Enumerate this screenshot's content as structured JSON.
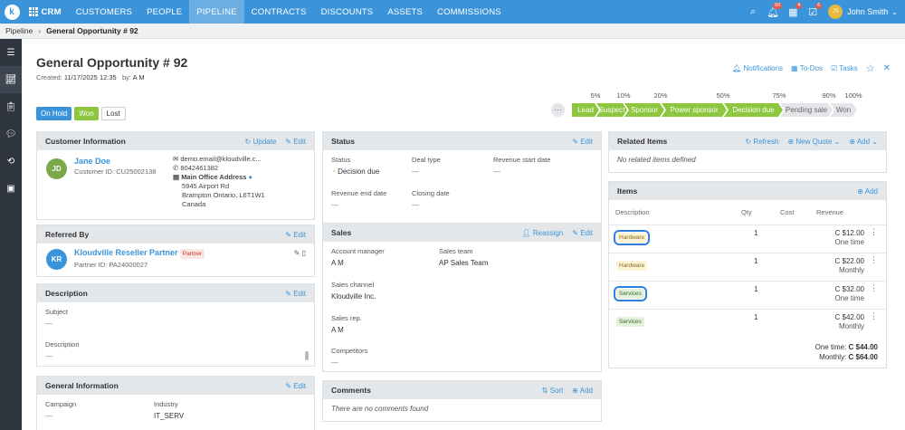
{
  "nav": {
    "app": "CRM",
    "items": [
      "CUSTOMERS",
      "PEOPLE",
      "PIPELINE",
      "CONTRACTS",
      "DISCOUNTS",
      "ASSETS",
      "COMMISSIONS"
    ],
    "active": "PIPELINE",
    "badges": {
      "notifications": "50",
      "todos": "4",
      "tasks": "6"
    },
    "user_initials": "JS",
    "user_name": "John Smith"
  },
  "breadcrumb": {
    "parent": "Pipeline",
    "current": "General Opportunity # 92"
  },
  "header": {
    "title": "General Opportunity # 92",
    "created_label": "Created:",
    "created_value": "11/17/2025 12:35",
    "by_label": "by:",
    "by_value": "A M",
    "notifications": "Notifications",
    "todos": "To-Dos",
    "tasks": "Tasks"
  },
  "status_buttons": {
    "on_hold": "On Hold",
    "won": "Won",
    "lost": "Lost"
  },
  "stages": [
    {
      "name": "Lead",
      "pct": "5%",
      "done": true
    },
    {
      "name": "Suspect",
      "pct": "10%",
      "done": true
    },
    {
      "name": "Sponsor",
      "pct": "20%",
      "done": true
    },
    {
      "name": "Power sponsor",
      "pct": "50%",
      "done": true
    },
    {
      "name": "Decision due",
      "pct": "75%",
      "done": true
    },
    {
      "name": "Pending sale",
      "pct": "90%",
      "done": false
    },
    {
      "name": "Won",
      "pct": "100%",
      "done": false
    }
  ],
  "customer": {
    "title": "Customer Information",
    "update": "Update",
    "edit": "Edit",
    "initials": "JD",
    "name": "Jane Doe",
    "id": "Customer ID: CU25002138",
    "email": "demo.email@kloudville.c...",
    "phone": "8042461382",
    "address_label": "Main Office Address",
    "address": [
      "5945 Airport Rd",
      "Brampton Ontario, L6T1W1",
      "Canada"
    ]
  },
  "referred": {
    "title": "Referred By",
    "edit": "Edit",
    "initials": "KR",
    "name": "Kloudville Reseller Partner",
    "tag": "Partner",
    "id": "Partner ID: PA24000027"
  },
  "description": {
    "title": "Description",
    "edit": "Edit",
    "subject_label": "Subject",
    "subject_value": "—",
    "desc_label": "Description",
    "desc_value": "—"
  },
  "general": {
    "title": "General Information",
    "edit": "Edit",
    "campaign_label": "Campaign",
    "campaign_value": "—",
    "industry_label": "Industry",
    "industry_value": "IT_SERV"
  },
  "status": {
    "title": "Status",
    "edit": "Edit",
    "status_label": "Status",
    "status_value": "Decision due",
    "deal_label": "Deal type",
    "deal_value": "—",
    "rev_start_label": "Revenue start date",
    "rev_start_value": "—",
    "rev_end_label": "Revenue end date",
    "rev_end_value": "—",
    "closing_label": "Closing date",
    "closing_value": "—"
  },
  "sales": {
    "title": "Sales",
    "reassign": "Reassign",
    "edit": "Edit",
    "manager_label": "Account manager",
    "manager_value": "A M",
    "team_label": "Sales team",
    "team_value": "AP Sales Team",
    "channel_label": "Sales channel",
    "channel_value": "Kloudville Inc.",
    "rep_label": "Sales rep.",
    "rep_value": "A M",
    "competitors_label": "Competitors",
    "competitors_value": "—"
  },
  "comments": {
    "title": "Comments",
    "sort": "Sort",
    "add": "Add",
    "empty": "There are no comments found"
  },
  "related": {
    "title": "Related Items",
    "refresh": "Refresh",
    "new_quote": "New Quote",
    "add": "Add",
    "empty": "No related items defined"
  },
  "items": {
    "title": "Items",
    "add": "Add",
    "col_desc": "Description",
    "col_qty": "Qty",
    "col_cost": "Cost",
    "col_rev": "Revenue",
    "rows": [
      {
        "tag": "Hardware",
        "type": "hw",
        "qty": "1",
        "rev": "C $12.00",
        "period": "One time",
        "highlight": true
      },
      {
        "tag": "Hardware",
        "type": "hw",
        "qty": "1",
        "rev": "C $22.00",
        "period": "Monthly",
        "highlight": false
      },
      {
        "tag": "Services",
        "type": "sv",
        "qty": "1",
        "rev": "C $32.00",
        "period": "One time",
        "highlight": true
      },
      {
        "tag": "Services",
        "type": "sv",
        "qty": "1",
        "rev": "C $42.00",
        "period": "Monthly",
        "highlight": false
      }
    ],
    "total_onetime_label": "One time:",
    "total_onetime": "C $44.00",
    "total_monthly_label": "Monthly:",
    "total_monthly": "C $64.00"
  }
}
